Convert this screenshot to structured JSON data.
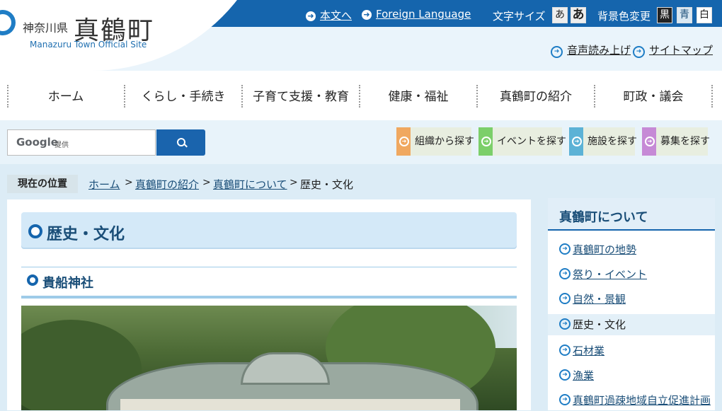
{
  "header": {
    "logo": {
      "prefecture": "神奈川県",
      "town": "真鶴町",
      "english": "Manazuru Town Official Site"
    },
    "topbar": {
      "skip_link": "本文へ",
      "foreign_link": "Foreign Language",
      "font_size_label": "文字サイズ",
      "font_small": "あ",
      "font_large": "あ",
      "bg_color_label": "背景色変更",
      "bg_black": "黒",
      "bg_blue": "青",
      "bg_white": "白"
    },
    "sub_links": {
      "read_aloud": "音声読み上げ",
      "sitemap": "サイトマップ"
    }
  },
  "nav": {
    "items": [
      "ホーム",
      "くらし・手続き",
      "子育て支援・教育",
      "健康・福祉",
      "真鶴町の紹介",
      "町政・議会"
    ]
  },
  "search": {
    "google_label": "Google",
    "google_sub": "提供",
    "placeholder": ""
  },
  "find_buttons": [
    {
      "label": "組織から探す",
      "color": "#f0a860"
    },
    {
      "label": "イベントを探す",
      "color": "#7ccf6a"
    },
    {
      "label": "施設を探す",
      "color": "#5cb2d6"
    },
    {
      "label": "募集を探す",
      "color": "#c68ad6"
    }
  ],
  "breadcrumb": {
    "label": "現在の位置",
    "items": [
      "ホーム",
      "真鶴町の紹介",
      "真鶴町について"
    ],
    "separator": ">",
    "current": "歴史・文化"
  },
  "main": {
    "title": "歴史・文化",
    "section_title": "貴船神社"
  },
  "sidebar": {
    "heading": "真鶴町について",
    "items": [
      {
        "label": "真鶴町の地勢",
        "current": false
      },
      {
        "label": "祭り・イベント",
        "current": false
      },
      {
        "label": "自然・景観",
        "current": false
      },
      {
        "label": "歴史・文化",
        "current": true
      },
      {
        "label": "石材業",
        "current": false
      },
      {
        "label": "漁業",
        "current": false
      },
      {
        "label": "真鶴町過疎地域自立促進計画",
        "current": false
      }
    ]
  },
  "icons": {
    "arrow": "arrow-right-circle-icon",
    "search": "search-icon"
  }
}
